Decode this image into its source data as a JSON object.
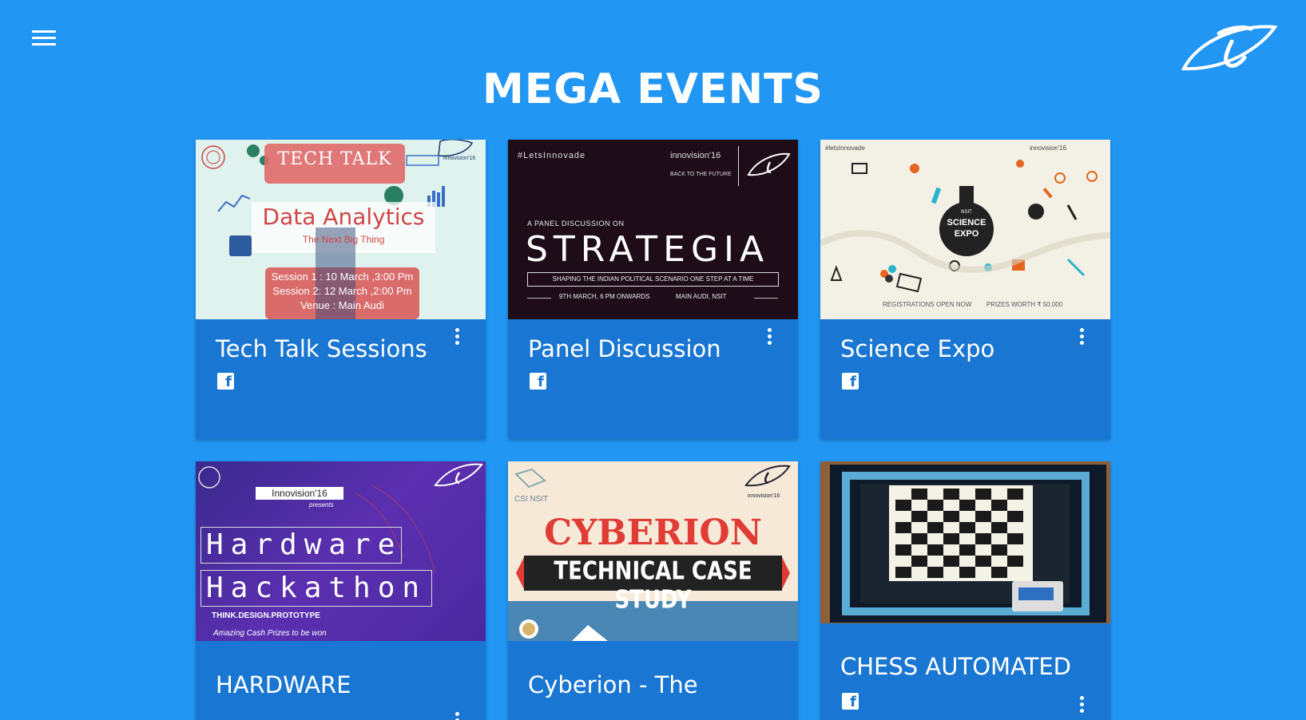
{
  "header": {
    "title": "MEGA EVENTS",
    "menu_icon": "hamburger-menu-icon",
    "logo_icon": "innovision-eye-logo"
  },
  "cards": [
    {
      "title": "Tech Talk Sessions",
      "image": {
        "hashtag": "",
        "banner_top": "TECH   TALK",
        "heading": "Data Analytics",
        "subheading": "The Next Big Thing",
        "line1": "Session 1 : 10 March ,3:00 Pm",
        "line2": "Session 2: 12 March ,2:00 Pm",
        "line3": "Venue : Main Audi",
        "brand": "innovision'16"
      }
    },
    {
      "title": "Panel Discussion",
      "image": {
        "hashtag": "#LetsInnovade",
        "brand": "innovision'16",
        "tagline": "BACK TO THE FUTURE",
        "pre": "A PANEL DISCUSSION ON",
        "heading": "STRATEGIA",
        "sub": "SHAPING THE INDIAN POLITICAL SCENARIO ONE STEP AT A TIME",
        "date": "9TH MARCH, 6 PM ONWARDS",
        "venue": "MAIN AUDI, NSIT"
      }
    },
    {
      "title": "Science Expo",
      "image": {
        "hashtag": "#letsInnovade",
        "brand": "innovision'16",
        "nsit": "NSIT",
        "heading1": "SCIENCE",
        "heading2": "EXPO",
        "footer1": "REGISTRATIONS OPEN NOW",
        "footer2": "PRIZES WORTH ₹ 50,000"
      }
    },
    {
      "title": "HARDWARE",
      "image": {
        "brand_box": "Innovision'16",
        "presents": "presents",
        "heading1": "Hardware",
        "heading2": "Hackathon",
        "tagline": "THINK.DESIGN.PROTOTYPE",
        "footer": "Amazing Cash Prizes to be won"
      }
    },
    {
      "title": "Cyberion - The",
      "image": {
        "org": "CSI NSIT",
        "brand": "innovision'16",
        "heading": "CYBERION",
        "banner": "TECHNICAL CASE STUDY"
      }
    },
    {
      "title": "CHESS AUTOMATED",
      "image": {}
    }
  ],
  "colors": {
    "background": "#2196F3",
    "card": "#1976D2",
    "text": "#FFFFFF"
  },
  "icons": {
    "facebook": "facebook-icon",
    "more": "more-vert-icon"
  }
}
